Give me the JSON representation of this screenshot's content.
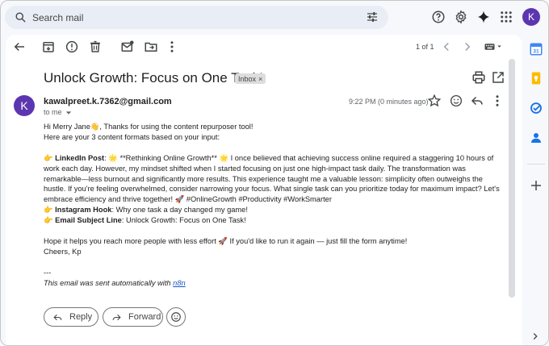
{
  "search": {
    "placeholder": "Search mail"
  },
  "account": {
    "initial": "K"
  },
  "toolbar": {
    "pager": "1 of 1"
  },
  "email": {
    "subject": "Unlock Growth: Focus on One Task!",
    "label": "Inbox",
    "label_close": "×",
    "sender_initial": "K",
    "sender": "kawalpreet.k.7362@gmail.com",
    "to": "to me",
    "time": "9:22 PM (0 minutes ago)",
    "lines": {
      "l1": "Hi Merry Jane👋, Thanks for using the content repurposer tool!",
      "l2": "Here are your 3 content formats based on your input:",
      "li_icon": "👉",
      "li_label": "LinkedIn Post",
      "li_text": ": 🌟 **Rethinking Online Growth** 🌟 I once believed that achieving success online required a staggering 10 hours of work each day. However, my mindset shifted when I started focusing on just one high-impact task daily. The transformation was remarkable—less burnout and significantly more results. This experience taught me a valuable lesson: simplicity often outweighs the hustle. If you're feeling overwhelmed, consider narrowing your focus. What single task can you prioritize today for maximum impact? Let's embrace efficiency and thrive together! 🚀 #OnlineGrowth #Productivity #WorkSmarter",
      "ig_icon": "👉",
      "ig_label": "Instagram Hook",
      "ig_text": ": Why one task a day changed my game!",
      "em_icon": "👉",
      "em_label": "Email Subject Line",
      "em_text": ": Unlock Growth: Focus on One Task!",
      "l_hope": "Hope it helps you reach more people with less effort 🚀 If you'd like to run it again — just fill the form anytime!",
      "l_cheers": "Cheers, Kp",
      "l_dash": "---",
      "auto": "This email was sent automatically with ",
      "auto_link": "n8n"
    },
    "reply_label": "Reply",
    "forward_label": "Forward"
  },
  "colors": {
    "accent": "#5c35b0",
    "link": "#1a56c5"
  }
}
